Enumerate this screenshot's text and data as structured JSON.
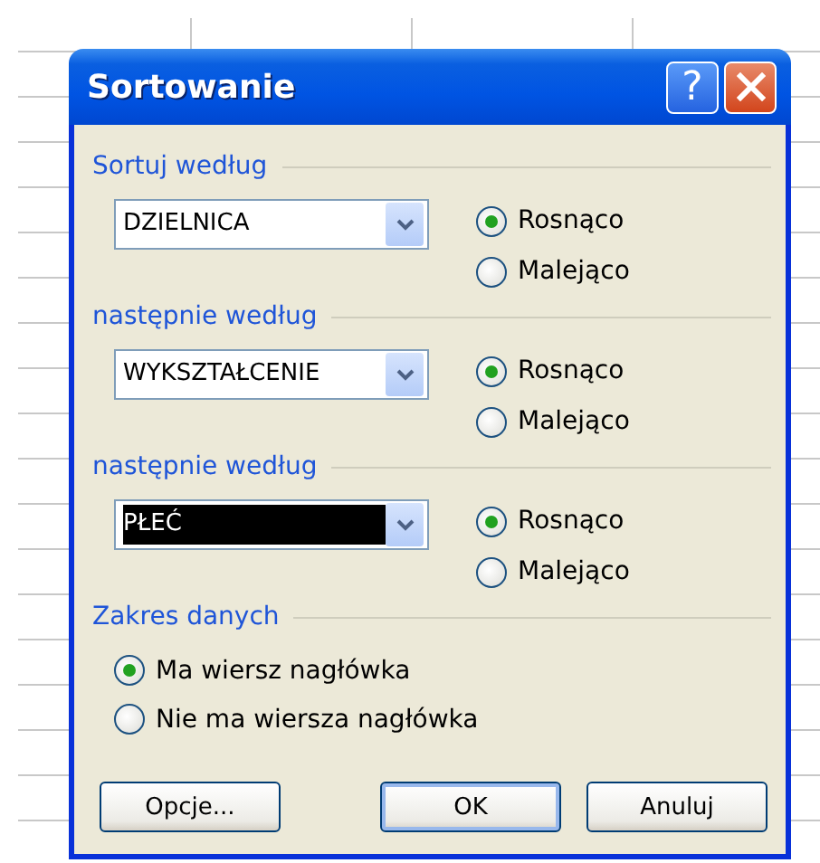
{
  "window": {
    "title": "Sortowanie"
  },
  "title_buttons": [
    {
      "kind": "help",
      "label": "?"
    },
    {
      "kind": "close"
    }
  ],
  "sort_keys": [
    {
      "heading": "Sortuj według",
      "field": {
        "value": "DZIELNICA",
        "highlighted": false
      },
      "order": [
        {
          "label": "Rosnąco",
          "selected": true
        },
        {
          "label": "Malejąco",
          "selected": false
        }
      ]
    },
    {
      "heading": "następnie według",
      "field": {
        "value": "WYKSZTAŁCENIE",
        "highlighted": false
      },
      "order": [
        {
          "label": "Rosnąco",
          "selected": true
        },
        {
          "label": "Malejąco",
          "selected": false
        }
      ]
    },
    {
      "heading": "następnie według",
      "field": {
        "value": "PŁEĆ",
        "highlighted": true
      },
      "order": [
        {
          "label": "Rosnąco",
          "selected": true
        },
        {
          "label": "Malejąco",
          "selected": false
        }
      ]
    }
  ],
  "range": {
    "heading": "Zakres danych",
    "options": [
      {
        "label": "Ma wiersz nagłówka",
        "selected": true
      },
      {
        "label": "Nie ma wiersza nagłówka",
        "selected": false
      }
    ]
  },
  "buttons": [
    {
      "label": "Opcje...",
      "default": false
    },
    {
      "label": "OK",
      "default": true
    },
    {
      "label": "Anuluj",
      "default": false
    }
  ]
}
